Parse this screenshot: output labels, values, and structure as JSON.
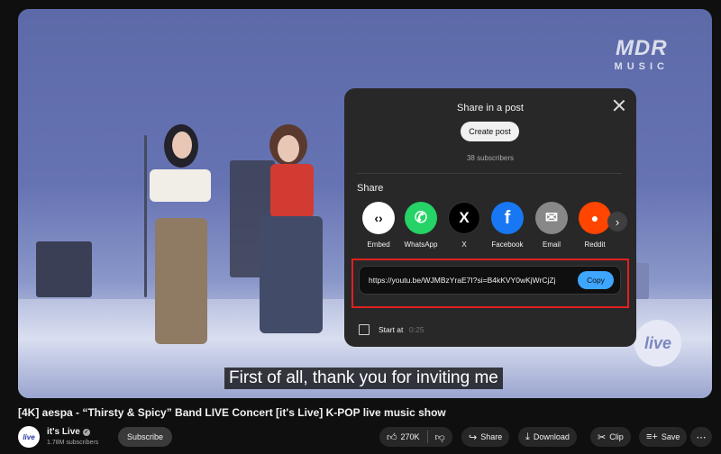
{
  "watermark": {
    "line1": "MDR",
    "line2": "MUSIC"
  },
  "live_logo": "live",
  "caption": "First of all, thank you for inviting me",
  "dialog": {
    "title": "Share in a post",
    "create_post_label": "Create post",
    "subscribers": "38 subscribers",
    "share_label": "Share",
    "share_targets": [
      {
        "label": "Embed",
        "icon": "embed-icon",
        "glyph": "‹›",
        "bg": "#ffffff",
        "fg": "#0f0f0f"
      },
      {
        "label": "WhatsApp",
        "icon": "whatsapp-icon",
        "glyph": "✆",
        "bg": "#25d366",
        "fg": "#ffffff"
      },
      {
        "label": "X",
        "icon": "x-icon",
        "glyph": "𝕏",
        "bg": "#000000",
        "fg": "#ffffff"
      },
      {
        "label": "Facebook",
        "icon": "facebook-icon",
        "glyph": "f",
        "bg": "#1877f2",
        "fg": "#ffffff"
      },
      {
        "label": "Email",
        "icon": "email-icon",
        "glyph": "✉",
        "bg": "#888888",
        "fg": "#ffffff"
      },
      {
        "label": "Reddit",
        "icon": "reddit-icon",
        "glyph": "●",
        "bg": "#ff4500",
        "fg": "#ffffff"
      }
    ],
    "url": "https://youtu.be/WJMBzYraE7I?si=B4kKVY0wKjWrCjZj",
    "copy_label": "Copy",
    "start_at_label": "Start at",
    "start_at_time": "0:25"
  },
  "video": {
    "title": "[4K] aespa - “Thirsty & Spicy” Band LIVE Concert [it's Live] K-POP live music show"
  },
  "channel": {
    "avatar_text": "live",
    "name": "it's Live",
    "subscribers": "1.78M subscribers",
    "subscribe_label": "Subscribe"
  },
  "actions": {
    "likes": "270K",
    "share": "Share",
    "download": "Download",
    "clip": "Clip",
    "save": "Save",
    "more": "⋯"
  },
  "colors": {
    "accent_blue": "#3ea6ff",
    "highlight_red": "#e02020",
    "dialog_bg": "#282828",
    "page_bg": "#0f0f0f"
  }
}
